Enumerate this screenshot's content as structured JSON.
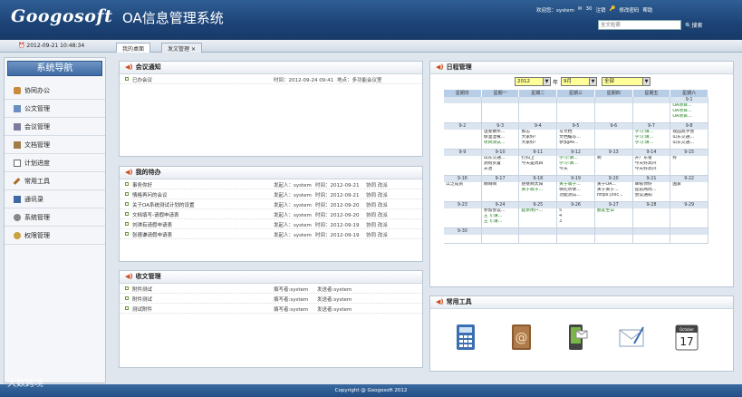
{
  "header": {
    "logo": "Googosoft",
    "title": "OA信息管理系统",
    "welcome": "欢迎您：system",
    "messages": "30",
    "logout": "注销",
    "change_password": "修改密码",
    "help": "帮助",
    "search_placeholder": "全文检索",
    "search_label": "搜索"
  },
  "tabbar": {
    "datetime": "2012-09-21 10:48:34",
    "tabs": [
      {
        "label": "我的桌面"
      },
      {
        "label": "发文管理"
      }
    ]
  },
  "nav": {
    "title": "系统导航",
    "items": [
      {
        "label": "协同办公"
      },
      {
        "label": "公文管理"
      },
      {
        "label": "会议管理"
      },
      {
        "label": "文档管理"
      },
      {
        "label": "计划进度"
      },
      {
        "label": "常用工具"
      },
      {
        "label": "通讯录"
      },
      {
        "label": "系统管理"
      },
      {
        "label": "权限管理"
      }
    ]
  },
  "meeting": {
    "title": "会议通知",
    "rows": [
      {
        "name": "已办会议",
        "time": "时间：2012-09-24 09:41",
        "place": "地点：多功能会议室"
      }
    ]
  },
  "todo": {
    "title": "我的待办",
    "rows": [
      {
        "name": "事务你好",
        "sender": "发起人：system",
        "time": "时间：2012-09-21",
        "proc": "协同 改派"
      },
      {
        "name": "情格再问的会议",
        "sender": "发起人：system",
        "time": "时间：2012-09-21",
        "proc": "协同 改派"
      },
      {
        "name": "关于OA系统测试计划的设置",
        "sender": "发起人：system",
        "time": "时间：2012-09-20",
        "proc": "协同 改派"
      },
      {
        "name": "文档填写-请假申请表",
        "sender": "发起人：system",
        "time": "时间：2012-09-20",
        "proc": "协同 改派"
      },
      {
        "name": "刘琪有请假申请表",
        "sender": "发起人：system",
        "time": "时间：2012-09-19",
        "proc": "协同 改派"
      },
      {
        "name": "张德谦请假申请表",
        "sender": "发起人：system",
        "time": "时间：2012-09-19",
        "proc": "协同 改派"
      }
    ]
  },
  "docs": {
    "title": "收文管理",
    "rows": [
      {
        "name": "附件测试",
        "writer": "撰写者:system",
        "sender": "发送者:system"
      },
      {
        "name": "附件测试",
        "writer": "撰写者:system",
        "sender": "发送者:system"
      },
      {
        "name": "测试附件",
        "writer": "撰写者:system",
        "sender": "发送者:system"
      }
    ]
  },
  "calendar": {
    "title": "日程管理",
    "year": "2012",
    "year_label": "年",
    "month": "9月",
    "filter": "全部",
    "weekdays": [
      "星期日",
      "星期一",
      "星期二",
      "星期三",
      "星期四",
      "星期五",
      "星期六"
    ],
    "weeks": [
      [
        {
          "d": ""
        },
        {
          "d": ""
        },
        {
          "d": ""
        },
        {
          "d": ""
        },
        {
          "d": ""
        },
        {
          "d": ""
        },
        {
          "d": "9-1",
          "ev": [
            "OA项目...",
            "OA项目...",
            "OA项目..."
          ]
        }
      ],
      [
        {
          "d": "9-2"
        },
        {
          "d": "9-3",
          "ev": [
            "湿发散水...",
            "保温湿雾...",
            "项目测试..."
          ]
        },
        {
          "d": "9-4",
          "ev": [
            "那志",
            "大家好!",
            "大家好!"
          ]
        },
        {
          "d": "9-5",
          "ev": [
            "写文档",
            "文档编写...",
            "参加JAV..."
          ]
        },
        {
          "d": "9-6"
        },
        {
          "d": "9-7",
          "ev": [
            "学习:请...",
            "学习:请...",
            "学习:请..."
          ]
        },
        {
          "d": "9-8",
          "ev": [
            "观园高手会",
            "山东交通...",
            "山东交通..."
          ]
        }
      ],
      [
        {
          "d": "9-9"
        },
        {
          "d": "9-10",
          "ev": [
            "山东交通...",
            "测购买置",
            "天池"
          ]
        },
        {
          "d": "9-11",
          "ev": [
            "打扫卫",
            "今天是周四"
          ]
        },
        {
          "d": "9-12",
          "ev": [
            "学习:请...",
            "学习:请...",
            "今天"
          ]
        },
        {
          "d": "9-13",
          "ev": [
            "啊"
          ]
        },
        {
          "d": "9-14",
          "ev": [
            "开广东省",
            "今天好高兴",
            "今天好高兴"
          ]
        },
        {
          "d": "9-15",
          "ev": [
            "好"
          ]
        }
      ],
      [
        {
          "d": "9-16",
          "ev": [
            "以泛成员"
          ]
        },
        {
          "d": "9-17",
          "ev": [
            "啊啊啊"
          ]
        },
        {
          "d": "9-18",
          "ev": [
            "感受啊太阳",
            "关于萌子..."
          ]
        },
        {
          "d": "9-19",
          "ev": [
            "关于萌子...",
            "佛陀听佛...",
            "功能测试..."
          ]
        },
        {
          "d": "9-20",
          "ev": [
            "关于OA...",
            "关于关于...",
            "https://loc..."
          ]
        },
        {
          "d": "9-21",
          "ev": [
            "审核你好",
            "提前两周...",
            "会议通知"
          ]
        },
        {
          "d": "9-22",
          "ev": [
            "国家"
          ]
        }
      ],
      [
        {
          "d": "9-23"
        },
        {
          "d": "9-24",
          "ev": [
            "参加会议...",
            "王飞:请...",
            "王飞:请..."
          ]
        },
        {
          "d": "9-25",
          "ev": [
            "起草用户..."
          ]
        },
        {
          "d": "9-26",
          "ev": [
            "5",
            "4",
            "3"
          ]
        },
        {
          "d": "9-27",
          "ev": [
            "朋友生日"
          ]
        },
        {
          "d": "9-28"
        },
        {
          "d": "9-29"
        }
      ],
      [
        {
          "d": "9-30"
        },
        {
          "d": ""
        },
        {
          "d": ""
        },
        {
          "d": ""
        },
        {
          "d": ""
        },
        {
          "d": ""
        },
        {
          "d": ""
        }
      ]
    ]
  },
  "tools": {
    "title": "常用工具",
    "calendar_icon_month": "October",
    "calendar_icon_day": "17"
  },
  "footer": {
    "copyright": "Copyright @ Googosoft 2012"
  },
  "watermark": "大数跨境"
}
